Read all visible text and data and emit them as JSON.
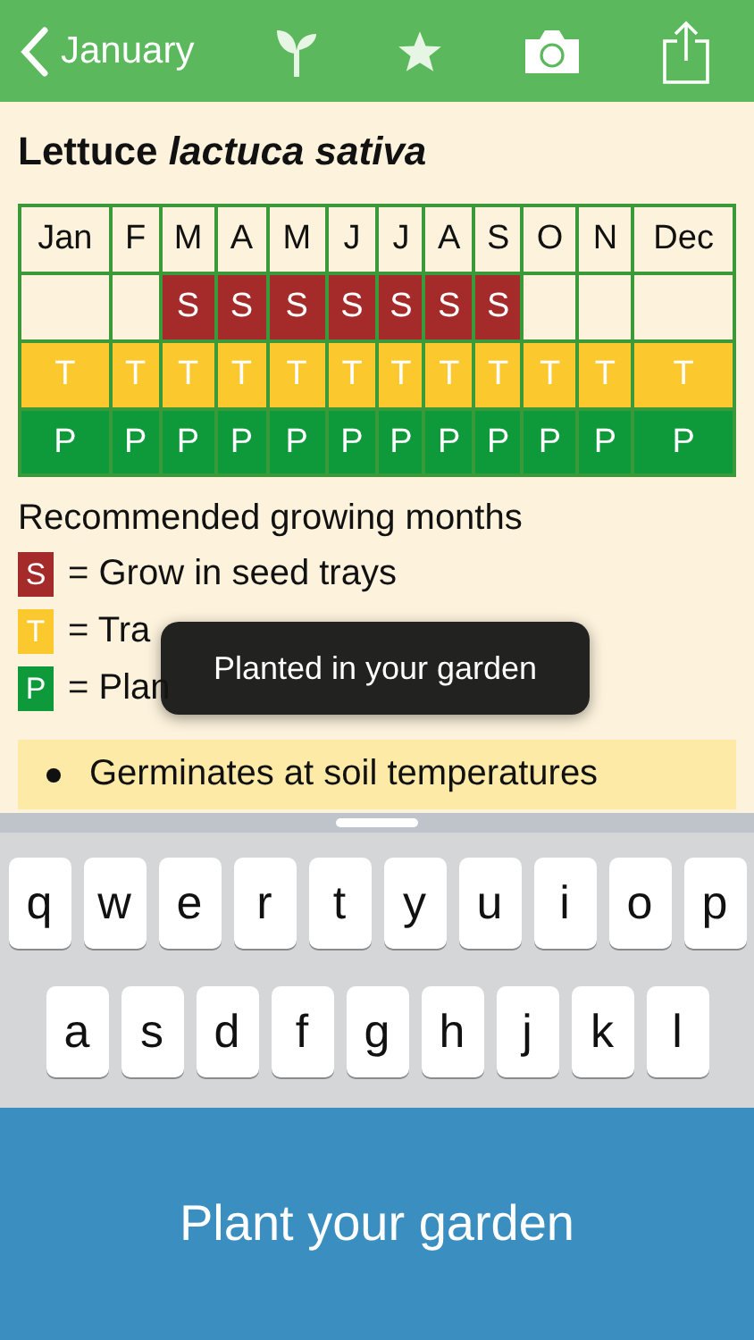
{
  "nav_bar": {
    "back_label": "January"
  },
  "title": {
    "text": "Lettuce *lactuca sativa*"
  },
  "calendar": {
    "months": [
      "Jan",
      "F",
      "M",
      "A",
      "M",
      "J",
      "J",
      "A",
      "S",
      "O",
      "N",
      "Dec"
    ],
    "rows": [
      {
        "color": "#a52a2a",
        "cells": [
          {
            "on": false
          },
          {
            "on": false
          },
          {
            "on": true,
            "label": "S"
          },
          {
            "on": true,
            "label": "S"
          },
          {
            "on": true,
            "label": "S"
          },
          {
            "on": true,
            "label": "S"
          },
          {
            "on": true,
            "label": "S"
          },
          {
            "on": true,
            "label": "S"
          },
          {
            "on": true,
            "label": "S"
          },
          {
            "on": false
          },
          {
            "on": false
          },
          {
            "on": false
          }
        ]
      },
      {
        "color": "#fbc82e",
        "cells": [
          {
            "on": true,
            "label": "T"
          },
          {
            "on": true,
            "label": "T"
          },
          {
            "on": true,
            "label": "T"
          },
          {
            "on": true,
            "label": "T"
          },
          {
            "on": true,
            "label": "T"
          },
          {
            "on": true,
            "label": "T"
          },
          {
            "on": true,
            "label": "T"
          },
          {
            "on": true,
            "label": "T"
          },
          {
            "on": true,
            "label": "T"
          },
          {
            "on": true,
            "label": "T"
          },
          {
            "on": true,
            "label": "T"
          },
          {
            "on": true,
            "label": "T"
          }
        ]
      },
      {
        "color": "#0e9a3a",
        "cells": [
          {
            "on": true,
            "label": "P"
          },
          {
            "on": true,
            "label": "P"
          },
          {
            "on": true,
            "label": "P"
          },
          {
            "on": true,
            "label": "P"
          },
          {
            "on": true,
            "label": "P"
          },
          {
            "on": true,
            "label": "P"
          },
          {
            "on": true,
            "label": "P"
          },
          {
            "on": true,
            "label": "P"
          },
          {
            "on": true,
            "label": "P"
          },
          {
            "on": true,
            "label": "P"
          },
          {
            "on": true,
            "label": "P"
          },
          {
            "on": true,
            "label": "P"
          }
        ]
      }
    ]
  },
  "legend": {
    "heading": "Recommended growing months",
    "items": [
      {
        "letter": "S",
        "color": "#a52a2a",
        "text": "= Grow in seed trays"
      },
      {
        "letter": "T",
        "color": "#fbc82e",
        "text": "= Tra"
      },
      {
        "letter": "P",
        "color": "#0e9a3a",
        "text": "= Plan"
      }
    ]
  },
  "notes": [
    "Germinates at soil temperatures"
  ],
  "toast": "Planted in your garden",
  "keyboard": {
    "rows": [
      [
        "q",
        "w",
        "e",
        "r",
        "t",
        "y",
        "u",
        "i",
        "o",
        "p"
      ],
      [
        "a",
        "s",
        "d",
        "f",
        "g",
        "h",
        "j",
        "k",
        "l"
      ]
    ]
  },
  "action_button": "Plant your garden"
}
